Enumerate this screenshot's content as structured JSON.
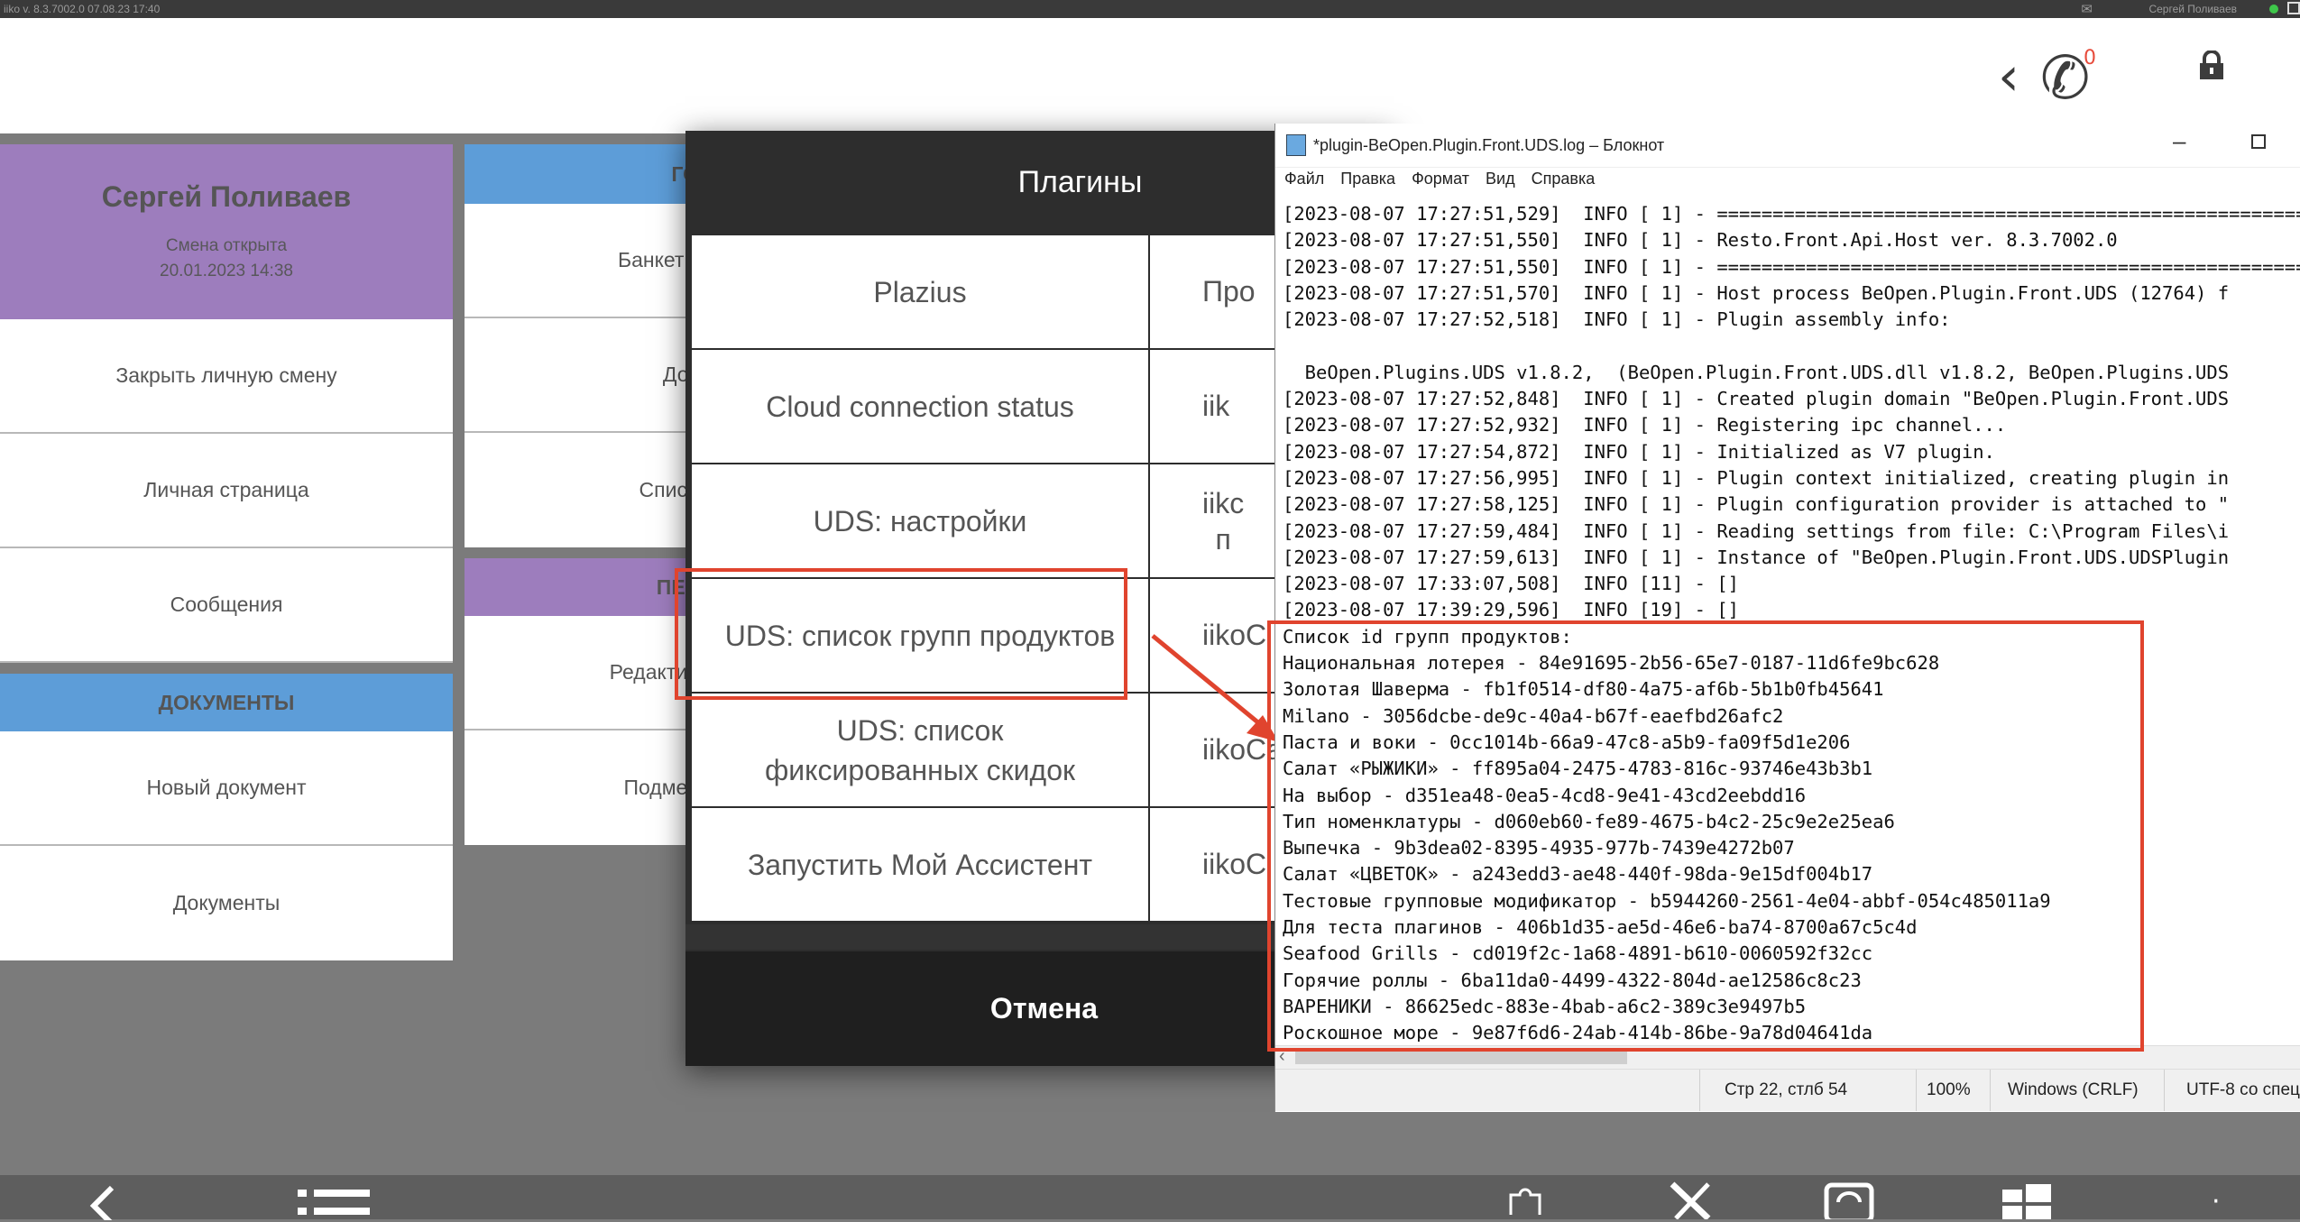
{
  "topbar": {
    "version": "iiko v. 8.3.7002.0   07.08.23   17:40",
    "user": "Сергей Поливаев"
  },
  "header": {
    "phone_count": "0",
    "icons": [
      "back-icon",
      "phone-icon",
      "lock-icon"
    ]
  },
  "left_menu": {
    "user_name": "Сергей Поливаев",
    "shift_status": "Смена открыта",
    "shift_date": "20.01.2023 14:38",
    "items": [
      "Закрыть личную смену",
      "Личная страница",
      "Сообщения"
    ],
    "documents_title": "ДОКУМЕНТЫ",
    "documents_items": [
      "Новый документ",
      "Документы"
    ]
  },
  "mid_menu": {
    "section1_title": "ГО",
    "section1_items": [
      "Банкеты",
      "Дос",
      "Списо"
    ],
    "section2_title": "ПЕР",
    "section2_items": [
      "Редактир",
      "Подмен"
    ]
  },
  "plugins_dialog": {
    "title": "Плагины",
    "rows": [
      {
        "name": "Plazius",
        "provider": "Про"
      },
      {
        "name": "Cloud connection status",
        "provider": "iik"
      },
      {
        "name": "UDS: настройки",
        "provider": "iikc\nп"
      },
      {
        "name": "UDS: список групп продуктов",
        "provider": "iikoC"
      },
      {
        "name": "UDS: список фиксированных скидок",
        "provider": "iikoCa"
      },
      {
        "name": "Запустить Мой Ассистент",
        "provider": "iikoC"
      }
    ],
    "cancel_label": "Отмена"
  },
  "notepad": {
    "window_title": "*plugin-BeOpen.Plugin.Front.UDS.log – Блокнот",
    "menu": [
      "Файл",
      "Правка",
      "Формат",
      "Вид",
      "Справка"
    ],
    "log_lines": [
      "[2023-08-07 17:27:51,529]  INFO [ 1] - ===================================================================",
      "[2023-08-07 17:27:51,550]  INFO [ 1] - Resto.Front.Api.Host ver. 8.3.7002.0",
      "[2023-08-07 17:27:51,550]  INFO [ 1] - ===================================================================",
      "[2023-08-07 17:27:51,570]  INFO [ 1] - Host process BeOpen.Plugin.Front.UDS (12764) f",
      "[2023-08-07 17:27:52,518]  INFO [ 1] - Plugin assembly info:",
      "",
      "  BeOpen.Plugins.UDS v1.8.2,  (BeOpen.Plugin.Front.UDS.dll v1.8.2, BeOpen.Plugins.UDS",
      "[2023-08-07 17:27:52,848]  INFO [ 1] - Created plugin domain \"BeOpen.Plugin.Front.UDS",
      "[2023-08-07 17:27:52,932]  INFO [ 1] - Registering ipc channel...",
      "[2023-08-07 17:27:54,872]  INFO [ 1] - Initialized as V7 plugin.",
      "[2023-08-07 17:27:56,995]  INFO [ 1] - Plugin context initialized, creating plugin in",
      "[2023-08-07 17:27:58,125]  INFO [ 1] - Plugin configuration provider is attached to \"",
      "[2023-08-07 17:27:59,484]  INFO [ 1] - Reading settings from file: C:\\Program Files\\i",
      "[2023-08-07 17:27:59,613]  INFO [ 1] - Instance of \"BeOpen.Plugin.Front.UDS.UDSPlugin",
      "[2023-08-07 17:33:07,508]  INFO [11] - []",
      "[2023-08-07 17:39:29,596]  INFO [19] - []",
      "Список id групп продуктов:",
      "Национальная лотерея - 84e91695-2b56-65e7-0187-11d6fe9bc628",
      "Золотая Шаверма - fb1f0514-df80-4a75-af6b-5b1b0fb45641",
      "Milano - 3056dcbe-de9c-40a4-b67f-eaefbd26afc2",
      "Паста и воки - 0cc1014b-66a9-47c8-a5b9-fa09f5d1e206",
      "Салат «РЫЖИКИ» - ff895a04-2475-4783-816c-93746e43b3b1",
      "На выбор - d351ea48-0ea5-4cd8-9e41-43cd2eebdd16",
      "Тип номенклатуры - d060eb60-fe89-4675-b4c2-25c9e2e25ea6",
      "Выпечка - 9b3dea02-8395-4935-977b-7439e4272b07",
      "Салат «ЦВЕТОК» - a243edd3-ae48-440f-98da-9e15df004b17",
      "Тестовые групповые модификатор - b5944260-2561-4e04-abbf-054c485011a9",
      "Для теста плагинов - 406b1d35-ae5d-46e6-ba74-8700a67c5c4d",
      "Seafood Grills - cd019f2c-1a68-4891-b610-0060592f32cc",
      "Горячие роллы - 6ba11da0-4499-4322-804d-ae12586c8c23",
      "ВАРЕНИКИ - 86625edc-883e-4bab-a6c2-389c3e9497b5",
      "Роскошное море - 9e87f6d6-24ab-414b-86be-9a78d04641da"
    ],
    "status": {
      "position": "Стр 22, стлб 54",
      "zoom": "100%",
      "line_endings": "Windows (CRLF)",
      "encoding": "UTF-8 со спец"
    }
  },
  "colors": {
    "highlight": "#e0442e",
    "user_block": "#9d7dbd",
    "section_blue": "#5d9dd8"
  },
  "bottom_icons": [
    "back-icon",
    "list-icon",
    "puzzle-icon",
    "tools-icon",
    "sync-icon",
    "windows-icon"
  ]
}
